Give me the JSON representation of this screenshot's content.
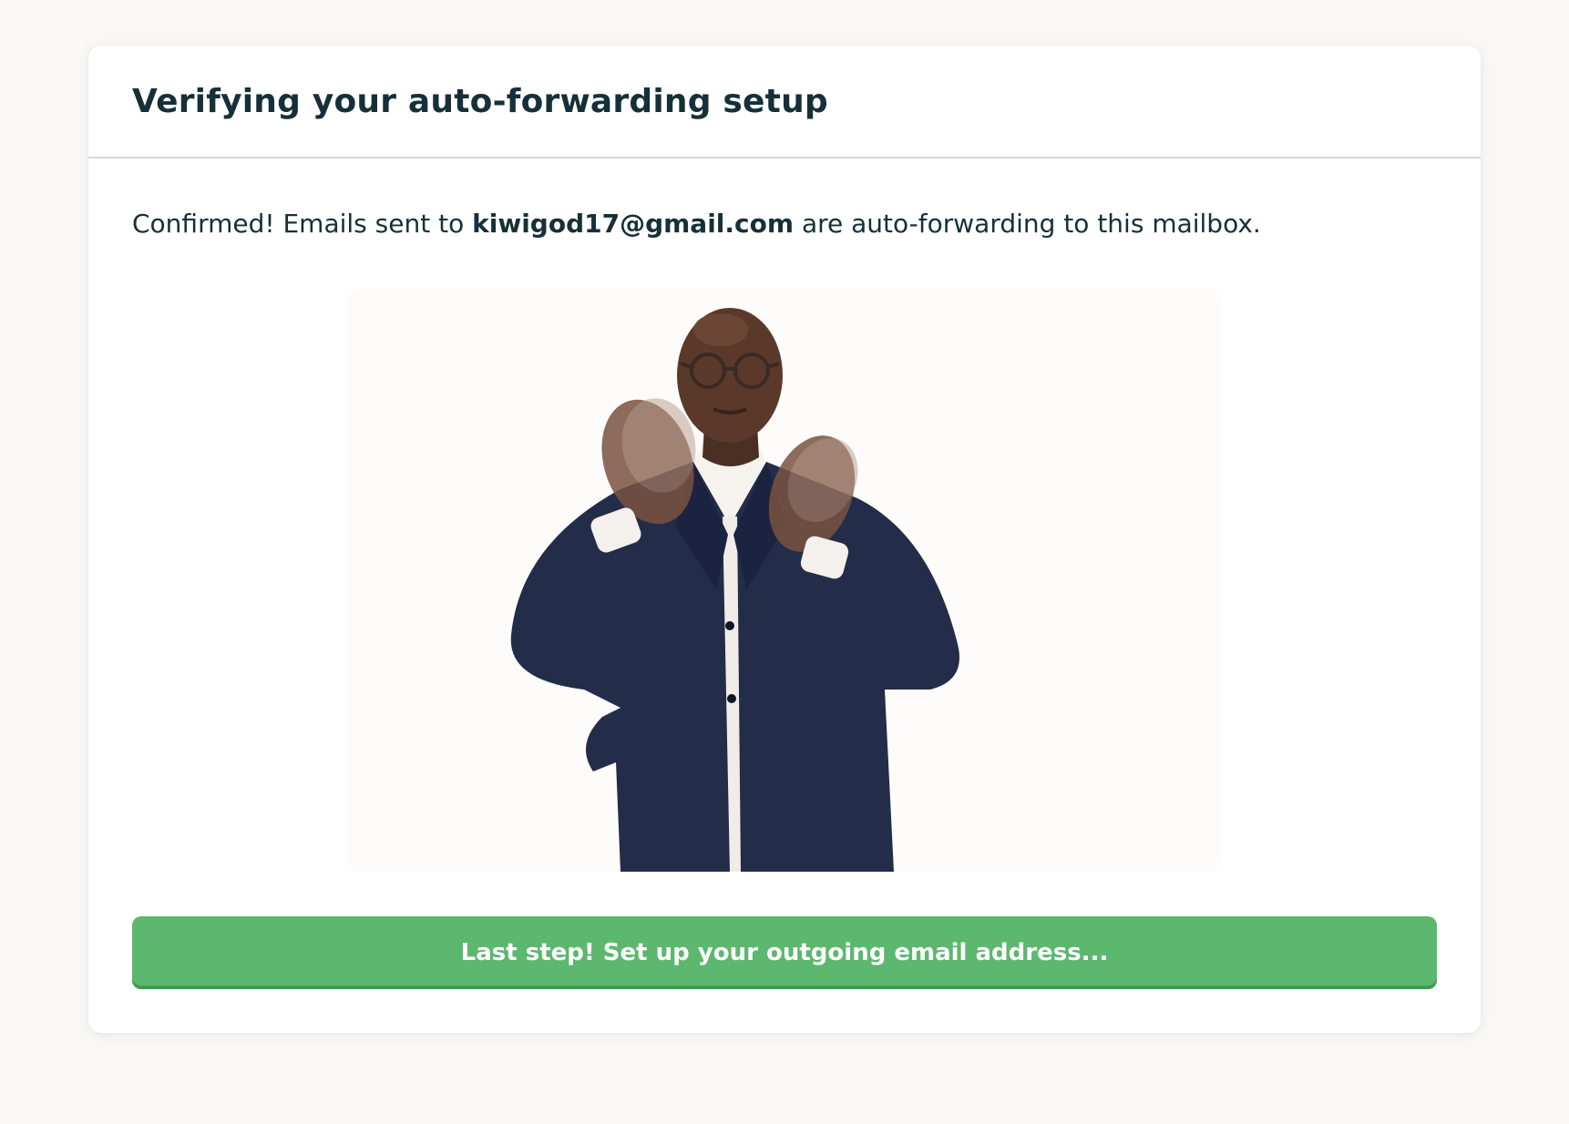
{
  "card": {
    "title": "Verifying your auto-forwarding setup",
    "message": {
      "prefix": "Confirmed! Emails sent to ",
      "email": "kiwigod17@gmail.com",
      "suffix": " are auto-forwarding to this mailbox."
    },
    "image": {
      "kind": "animated-gif",
      "background_color": "#fefcfa"
    },
    "cta_button": {
      "label": "Last step! Set up your outgoing email address...",
      "color": "#5cb76f"
    }
  },
  "colors": {
    "page_background": "#f9f8f6",
    "card_background": "#ffffff",
    "text": "#163039",
    "divider": "#d3d6d8"
  }
}
